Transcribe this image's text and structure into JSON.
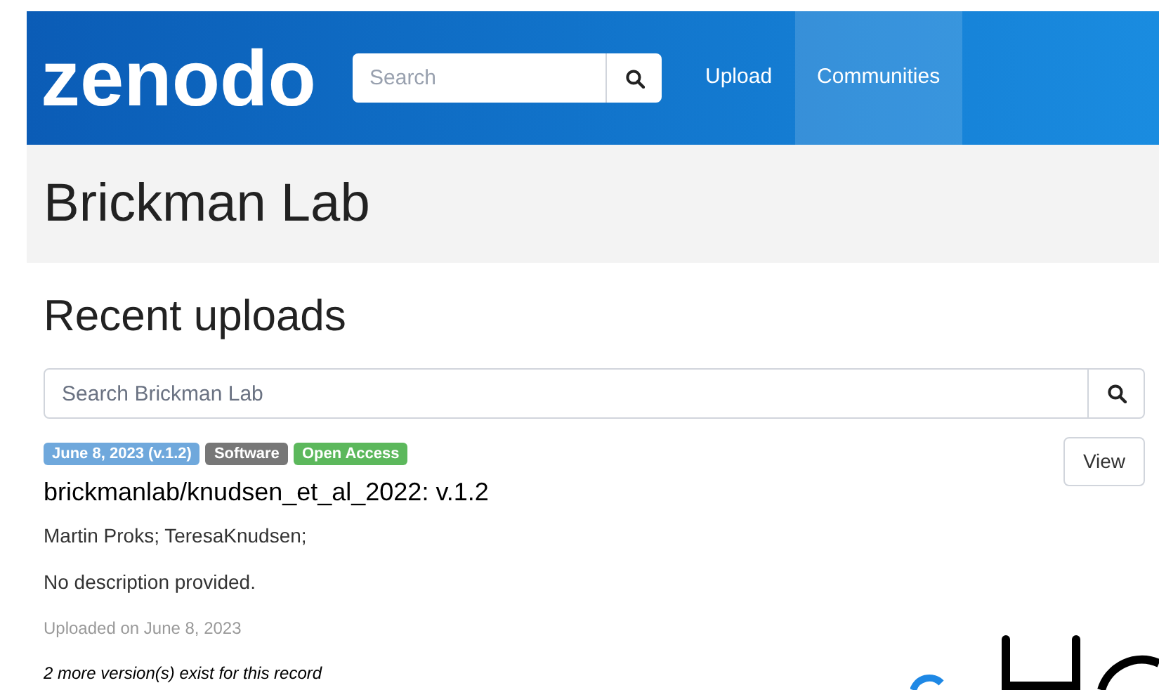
{
  "header": {
    "logo": "zenodo",
    "search": {
      "placeholder": "Search"
    },
    "nav": [
      {
        "label": "Upload",
        "selected": false
      },
      {
        "label": "Communities",
        "selected": true
      }
    ]
  },
  "community": {
    "title": "Brickman Lab"
  },
  "section_title": "Recent uploads",
  "community_search": {
    "placeholder": "Search Brickman Lab"
  },
  "records": [
    {
      "badges": [
        {
          "label": "June 8, 2023 (v.1.2)",
          "color": "#6fa8dc"
        },
        {
          "label": "Software",
          "color": "#777777"
        },
        {
          "label": "Open Access",
          "color": "#5cb85c"
        }
      ],
      "title": "brickmanlab/knudsen_et_al_2022: v.1.2",
      "authors": "Martin Proks; TeresaKnudsen;",
      "description": "No description provided.",
      "uploaded": "Uploaded on June 8, 2023",
      "versions": "2 more version(s) exist for this record",
      "button": "View"
    }
  ]
}
